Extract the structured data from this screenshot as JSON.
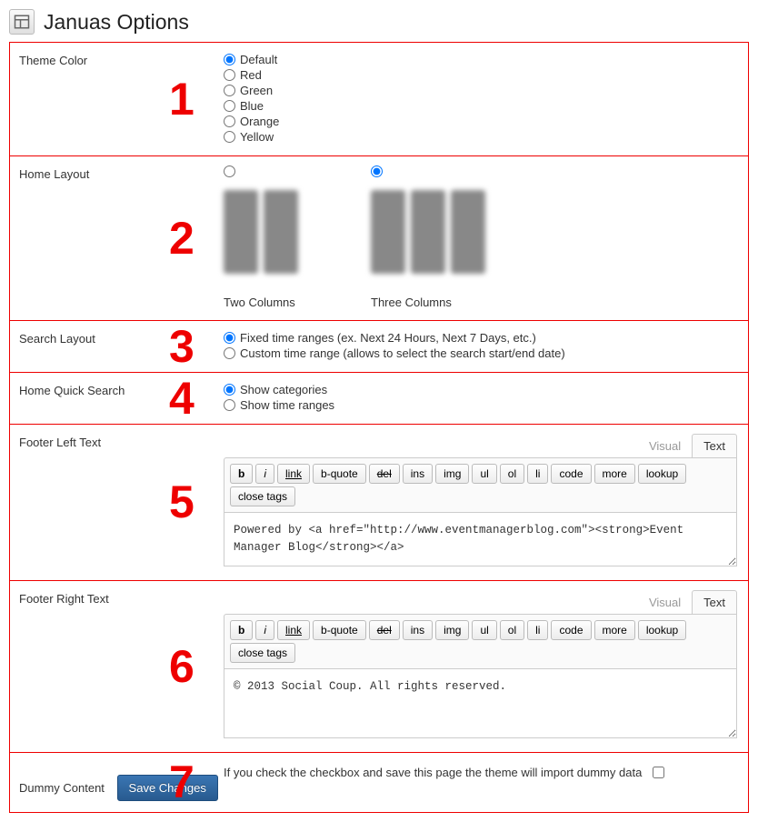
{
  "page": {
    "title": "Januas Options"
  },
  "numbers": [
    "1",
    "2",
    "3",
    "4",
    "5",
    "6",
    "7"
  ],
  "sections": {
    "theme": {
      "label": "Theme Color",
      "options": [
        "Default",
        "Red",
        "Green",
        "Blue",
        "Orange",
        "Yellow"
      ],
      "selected": 0
    },
    "homeLayout": {
      "label": "Home Layout",
      "options": [
        "Two Columns",
        "Three Columns"
      ],
      "selected": 1
    },
    "searchLayout": {
      "label": "Search Layout",
      "options": [
        "Fixed time ranges (ex. Next 24 Hours, Next 7 Days, etc.)",
        "Custom time range (allows to select the search start/end date)"
      ],
      "selected": 0
    },
    "quickSearch": {
      "label": "Home Quick Search",
      "options": [
        "Show categories",
        "Show time ranges"
      ],
      "selected": 0
    },
    "footerLeft": {
      "label": "Footer Left Text",
      "value": "Powered by <a href=\"http://www.eventmanagerblog.com\"><strong>Event Manager Blog</strong></a>"
    },
    "footerRight": {
      "label": "Footer Right Text",
      "value": "© 2013 Social Coup. All rights reserved."
    },
    "dummy": {
      "label": "Dummy Content",
      "text": "If you check the checkbox and save this page the theme will import dummy data",
      "checked": false
    }
  },
  "editor": {
    "tabs": {
      "visual": "Visual",
      "text": "Text"
    },
    "buttons": [
      "b",
      "i",
      "link",
      "b-quote",
      "del",
      "ins",
      "img",
      "ul",
      "ol",
      "li",
      "code",
      "more",
      "lookup",
      "close tags"
    ]
  },
  "actions": {
    "save": "Save Changes"
  }
}
